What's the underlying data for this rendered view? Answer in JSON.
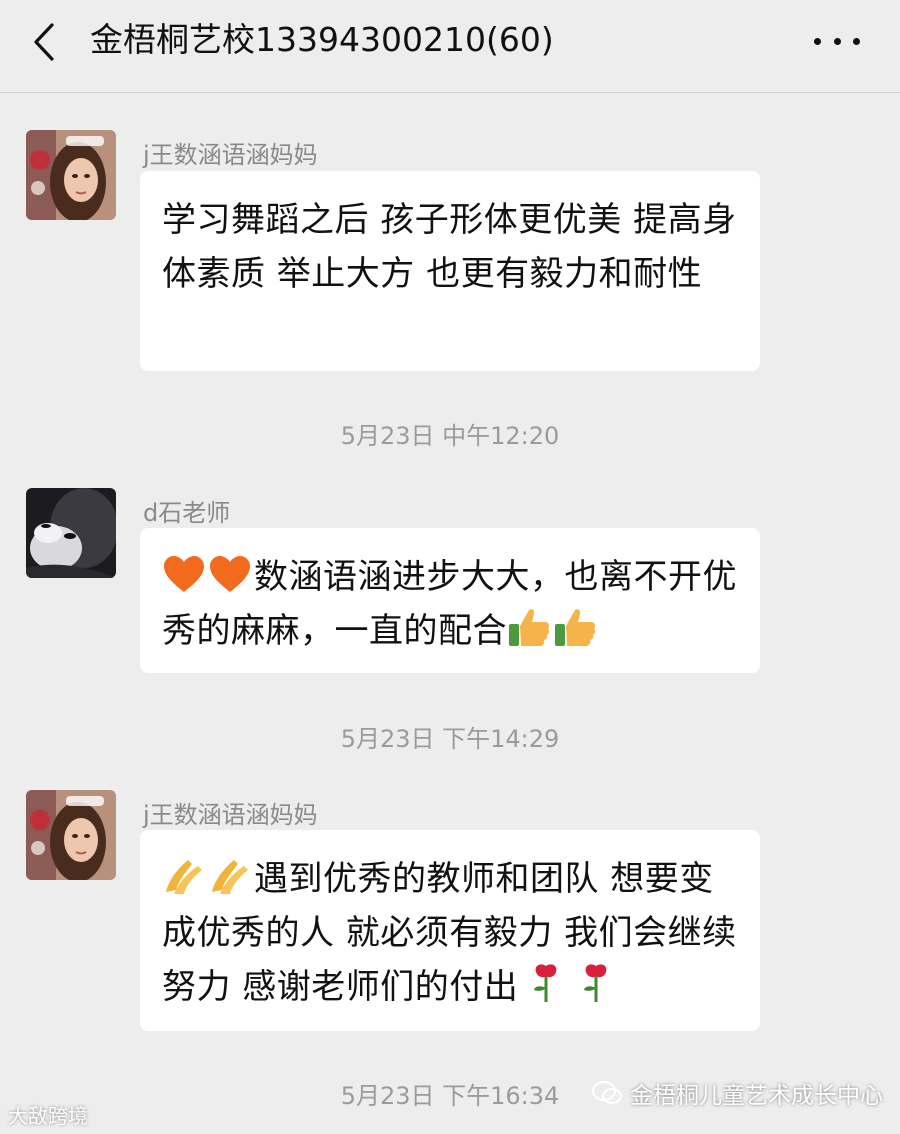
{
  "header": {
    "title": "金梧桐艺校13394300210(60)"
  },
  "icons": {
    "back": "chevron-left-icon",
    "more": "more-dots-icon"
  },
  "messages": [
    {
      "sender": "j王数涵语涵妈妈",
      "text": "学习舞蹈之后 孩子形体更优美 提高身体素质 举止大方 也更有毅力和耐性",
      "timestamp": "5月23日 中午12:20"
    },
    {
      "sender": "d石老师",
      "text": "数涵语涵进步大大，也离不开优秀的麻麻，一直的配合",
      "emoji_leading": [
        "orange-heart-icon",
        "orange-heart-icon"
      ],
      "emoji_trailing": [
        "thumbs-up-icon",
        "thumbs-up-icon"
      ],
      "timestamp": "5月23日 下午14:29"
    },
    {
      "sender": "j王数涵语涵妈妈",
      "text": "遇到优秀的教师和团队 想要变成优秀的人 就必须有毅力 我们会继续努力 感谢老师们的付出",
      "emoji_leading": [
        "clapping-hands-icon",
        "clapping-hands-icon"
      ],
      "emoji_trailing": [
        "rose-icon",
        "rose-icon"
      ],
      "timestamp": "5月23日 下午16:34"
    }
  ],
  "watermarks": {
    "left": "大敌跨境",
    "right": "金梧桐儿童艺术成长中心"
  },
  "colors": {
    "background": "#ededed",
    "bubble": "#ffffff",
    "sender": "#8a8a8a",
    "timestamp": "#9b9b9b"
  }
}
